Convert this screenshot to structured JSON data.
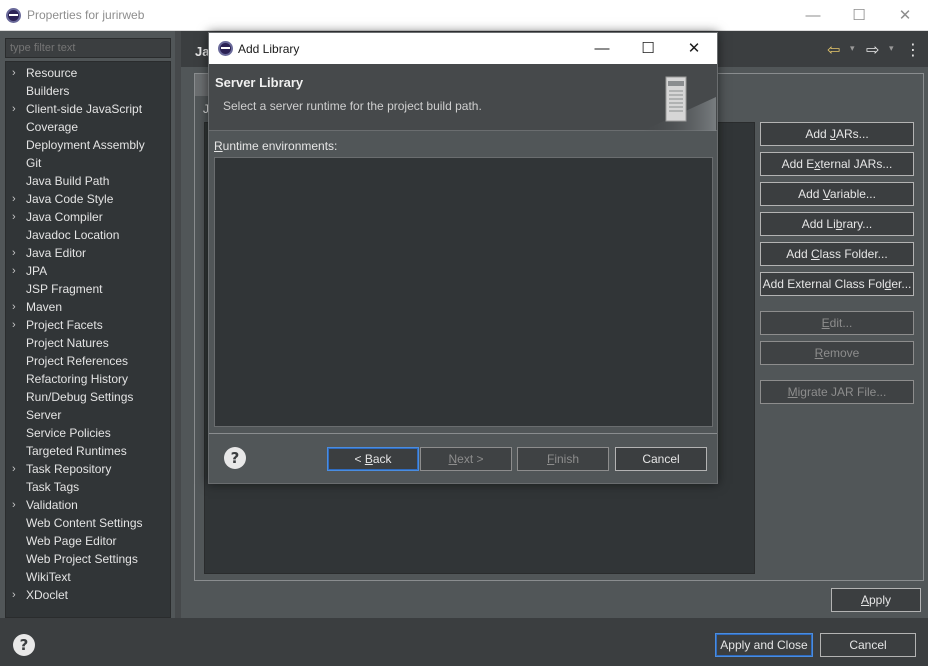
{
  "window": {
    "title": "Properties for jurirweb",
    "minimize_glyph": "—",
    "maximize_glyph": "☐",
    "close_glyph": "✕"
  },
  "filter": {
    "placeholder": "type filter text"
  },
  "tree_items": [
    {
      "label": "Resource",
      "expandable": true
    },
    {
      "label": "Builders",
      "expandable": false
    },
    {
      "label": "Client-side JavaScript",
      "expandable": true
    },
    {
      "label": "Coverage",
      "expandable": false
    },
    {
      "label": "Deployment Assembly",
      "expandable": false
    },
    {
      "label": "Git",
      "expandable": false
    },
    {
      "label": "Java Build Path",
      "expandable": false
    },
    {
      "label": "Java Code Style",
      "expandable": true
    },
    {
      "label": "Java Compiler",
      "expandable": true
    },
    {
      "label": "Javadoc Location",
      "expandable": false
    },
    {
      "label": "Java Editor",
      "expandable": true
    },
    {
      "label": "JPA",
      "expandable": true
    },
    {
      "label": "JSP Fragment",
      "expandable": false
    },
    {
      "label": "Maven",
      "expandable": true
    },
    {
      "label": "Project Facets",
      "expandable": true
    },
    {
      "label": "Project Natures",
      "expandable": false
    },
    {
      "label": "Project References",
      "expandable": false
    },
    {
      "label": "Refactoring History",
      "expandable": false
    },
    {
      "label": "Run/Debug Settings",
      "expandable": false
    },
    {
      "label": "Server",
      "expandable": false
    },
    {
      "label": "Service Policies",
      "expandable": false
    },
    {
      "label": "Targeted Runtimes",
      "expandable": false
    },
    {
      "label": "Task Repository",
      "expandable": true
    },
    {
      "label": "Task Tags",
      "expandable": false
    },
    {
      "label": "Validation",
      "expandable": true
    },
    {
      "label": "Web Content Settings",
      "expandable": false
    },
    {
      "label": "Web Page Editor",
      "expandable": false
    },
    {
      "label": "Web Project Settings",
      "expandable": false
    },
    {
      "label": "WikiText",
      "expandable": false
    },
    {
      "label": "XDoclet",
      "expandable": true
    }
  ],
  "page": {
    "title": "Ja",
    "back_glyph": "⇦",
    "forward_glyph": "⇨",
    "dropdown_glyph": "▾",
    "menu_glyph": "⋮",
    "tab_label": "J"
  },
  "side_buttons": [
    {
      "pre": "Add ",
      "mn": "J",
      "post": "ARs...",
      "enabled": true
    },
    {
      "pre": "Add E",
      "mn": "x",
      "post": "ternal JARs...",
      "enabled": true
    },
    {
      "pre": "Add ",
      "mn": "V",
      "post": "ariable...",
      "enabled": true
    },
    {
      "pre": "Add Li",
      "mn": "b",
      "post": "rary...",
      "enabled": true
    },
    {
      "pre": "Add ",
      "mn": "C",
      "post": "lass Folder...",
      "enabled": true
    },
    {
      "pre": "Add External Class Fol",
      "mn": "d",
      "post": "er...",
      "enabled": true
    },
    {
      "pre": "",
      "mn": "E",
      "post": "dit...",
      "enabled": false
    },
    {
      "pre": "",
      "mn": "R",
      "post": "emove",
      "enabled": false
    },
    {
      "pre": "",
      "mn": "M",
      "post": "igrate JAR File...",
      "enabled": false
    }
  ],
  "apply": {
    "pre": "",
    "mn": "A",
    "post": "pply"
  },
  "bottom": {
    "help_glyph": "?",
    "apply_close": "Apply and Close",
    "cancel": "Cancel"
  },
  "dialog": {
    "title": "Add Library",
    "minimize_glyph": "—",
    "maximize_glyph": "☐",
    "close_glyph": "✕",
    "heading": "Server Library",
    "description": "Select a server runtime for the project build path.",
    "runtime_label": {
      "pre": "",
      "mn": "R",
      "post": "untime environments:"
    },
    "help_glyph": "?",
    "back": {
      "pre": "< ",
      "mn": "B",
      "post": "ack"
    },
    "next": {
      "pre": "",
      "mn": "N",
      "post": "ext >"
    },
    "finish": {
      "pre": "",
      "mn": "F",
      "post": "inish"
    },
    "cancel": "Cancel"
  }
}
